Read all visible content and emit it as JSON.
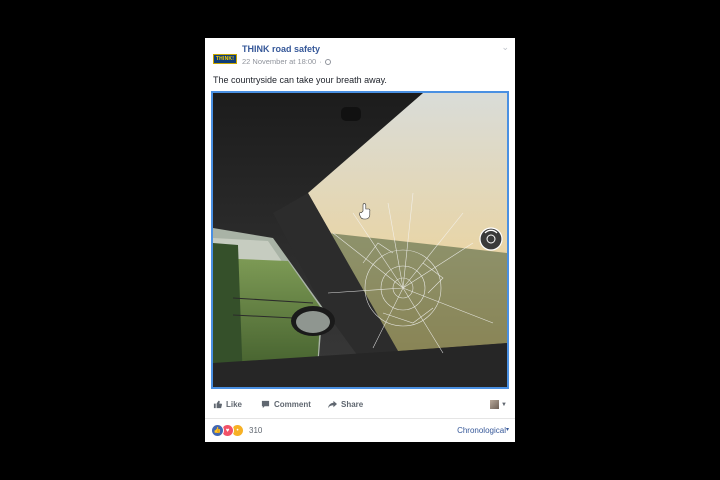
{
  "post": {
    "page_name": "THINK road safety",
    "logo_text": "THINK!",
    "timestamp": "22 November at 18:00",
    "separator": "·",
    "text": "The countryside can take your breath away.",
    "audience_icon": "globe-icon",
    "options_icon": "chevron-down-icon"
  },
  "media": {
    "description_icon": "video-360-dial-icon"
  },
  "actions": {
    "like": "Like",
    "comment": "Comment",
    "share": "Share"
  },
  "reactions": {
    "types": [
      "like",
      "love",
      "wow"
    ],
    "count": "310",
    "sort_label": "Chronological"
  },
  "colors": {
    "link": "#365899",
    "media_border": "#4a90e2",
    "background": "#000000"
  }
}
